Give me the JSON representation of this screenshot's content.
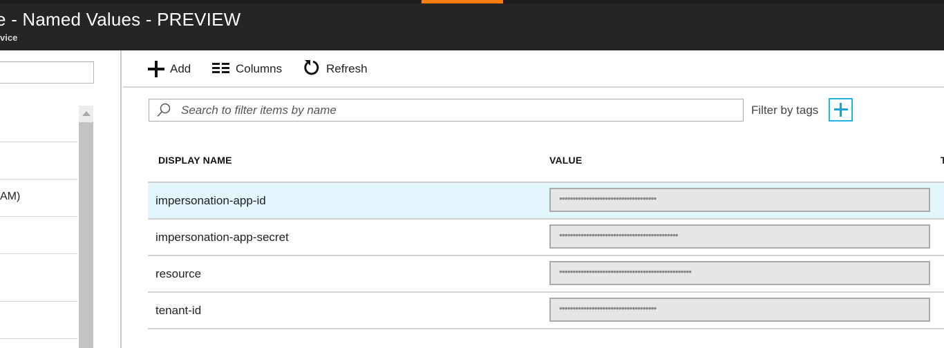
{
  "header": {
    "title": "e - Named Values - PREVIEW",
    "subtitle": "vice",
    "accent_color": "#ff7f00",
    "background_color": "#252525"
  },
  "left_pane": {
    "search_value": "",
    "items": [
      {
        "label": ""
      },
      {
        "label": ""
      },
      {
        "label": "AM)"
      },
      {
        "label": ""
      },
      {
        "label": ""
      },
      {
        "label": ""
      }
    ]
  },
  "toolbar": {
    "add_label": "Add",
    "add_icon": "plus-icon",
    "columns_label": "Columns",
    "columns_icon": "columns-icon",
    "refresh_label": "Refresh",
    "refresh_icon": "refresh-icon"
  },
  "search": {
    "placeholder": "Search to filter items by name",
    "value": "",
    "icon": "search-icon"
  },
  "filter": {
    "label": "Filter by tags",
    "add_icon": "plus-icon",
    "accent_color": "#1a9fdc"
  },
  "table": {
    "columns": [
      "DISPLAY NAME",
      "VALUE",
      "T"
    ],
    "rows": [
      {
        "name": "impersonation-app-id",
        "value": "••••••••••••••••••••••••••••••••••••",
        "selected": true
      },
      {
        "name": "impersonation-app-secret",
        "value": "••••••••••••••••••••••••••••••••••••••••••••",
        "selected": false
      },
      {
        "name": "resource",
        "value": "•••••••••••••••••••••••••••••••••••••••••••••••••",
        "selected": false
      },
      {
        "name": "tenant-id",
        "value": "••••••••••••••••••••••••••••••••••••",
        "selected": false
      }
    ],
    "selected_row_color": "#e3f6fb"
  }
}
